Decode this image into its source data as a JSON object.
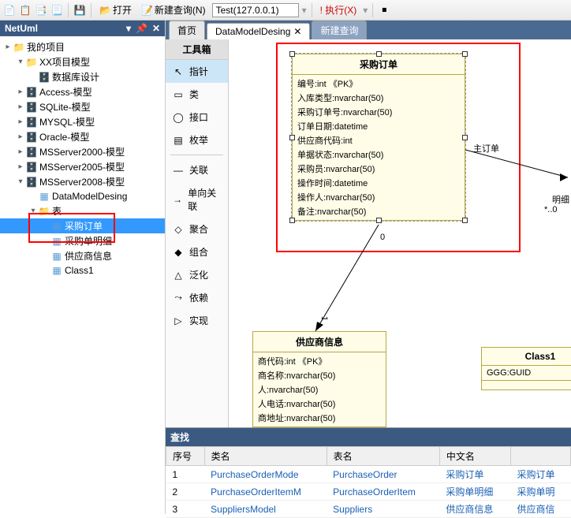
{
  "toolbar": {
    "open": "打开",
    "new_query": "新建查询(N)",
    "connection": "Test(127.0.0.1)",
    "execute": "! 执行(X)"
  },
  "left": {
    "title": "NetUml",
    "nodes": [
      {
        "d": 0,
        "t": "▸",
        "i": "folder",
        "l": "我的项目"
      },
      {
        "d": 1,
        "t": "▾",
        "i": "folder",
        "l": "XX项目模型"
      },
      {
        "d": 2,
        "t": "",
        "i": "db",
        "l": "数据库设计"
      },
      {
        "d": 1,
        "t": "▸",
        "i": "db",
        "l": "Access-模型"
      },
      {
        "d": 1,
        "t": "▸",
        "i": "db",
        "l": "SQLite-模型"
      },
      {
        "d": 1,
        "t": "▸",
        "i": "db",
        "l": "MYSQL-模型"
      },
      {
        "d": 1,
        "t": "▸",
        "i": "db",
        "l": "Oracle-模型"
      },
      {
        "d": 1,
        "t": "▸",
        "i": "db",
        "l": "MSServer2000-模型"
      },
      {
        "d": 1,
        "t": "▸",
        "i": "db",
        "l": "MSServer2005-模型"
      },
      {
        "d": 1,
        "t": "▾",
        "i": "db",
        "l": "MSServer2008-模型"
      },
      {
        "d": 2,
        "t": "",
        "i": "tbl",
        "l": "DataModelDesing"
      },
      {
        "d": 2,
        "t": "▾",
        "i": "folder",
        "l": "表"
      },
      {
        "d": 3,
        "t": "",
        "i": "tbl",
        "l": "采购订单",
        "sel": true
      },
      {
        "d": 3,
        "t": "",
        "i": "tbl",
        "l": "采购单明细"
      },
      {
        "d": 3,
        "t": "",
        "i": "tbl",
        "l": "供应商信息"
      },
      {
        "d": 3,
        "t": "",
        "i": "tbl",
        "l": "Class1"
      }
    ]
  },
  "tabs": {
    "home": "首页",
    "t1": "DataModelDesing",
    "t2": "新建查询"
  },
  "toolbox": {
    "title": "工具箱",
    "items": [
      "指针",
      "类",
      "接口",
      "枚举",
      "关联",
      "单向关联",
      "聚合",
      "组合",
      "泛化",
      "依赖",
      "实现"
    ]
  },
  "uml": {
    "c1": {
      "title": "采购订单",
      "rows": [
        "编号:int 《PK》",
        "入库类型:nvarchar(50)",
        "采购订单号:nvarchar(50)",
        "订单日期:datetime",
        "供应商代码:int",
        "单据状态:nvarchar(50)",
        "采购员:nvarchar(50)",
        "操作时间:datetime",
        "操作人:nvarchar(50)",
        "备注:nvarchar(50)"
      ]
    },
    "c2": {
      "title": "供应商信息",
      "rows": [
        "商代码:int 《PK》",
        "商名称:nvarchar(50)",
        "人:nvarchar(50)",
        "人电话:nvarchar(50)",
        "商地址:nvarchar(50)"
      ]
    },
    "c3": {
      "title": "Class1",
      "rows": [
        "GGG:GUID"
      ]
    },
    "lbl1": "主订单",
    "lbl2": "明细",
    "lbl3": "*..0"
  },
  "find": {
    "title": "查找",
    "cols": [
      "序号",
      "类名",
      "表名",
      "中文名",
      ""
    ],
    "rows": [
      [
        "1",
        "PurchaseOrderMode",
        "PurchaseOrder",
        "采购订单",
        "采购订单"
      ],
      [
        "2",
        "PurchaseOrderItemM",
        "PurchaseOrderItem",
        "采购单明细",
        "采购单明"
      ],
      [
        "3",
        "SuppliersModel",
        "Suppliers",
        "供应商信息",
        "供应商信"
      ]
    ]
  }
}
